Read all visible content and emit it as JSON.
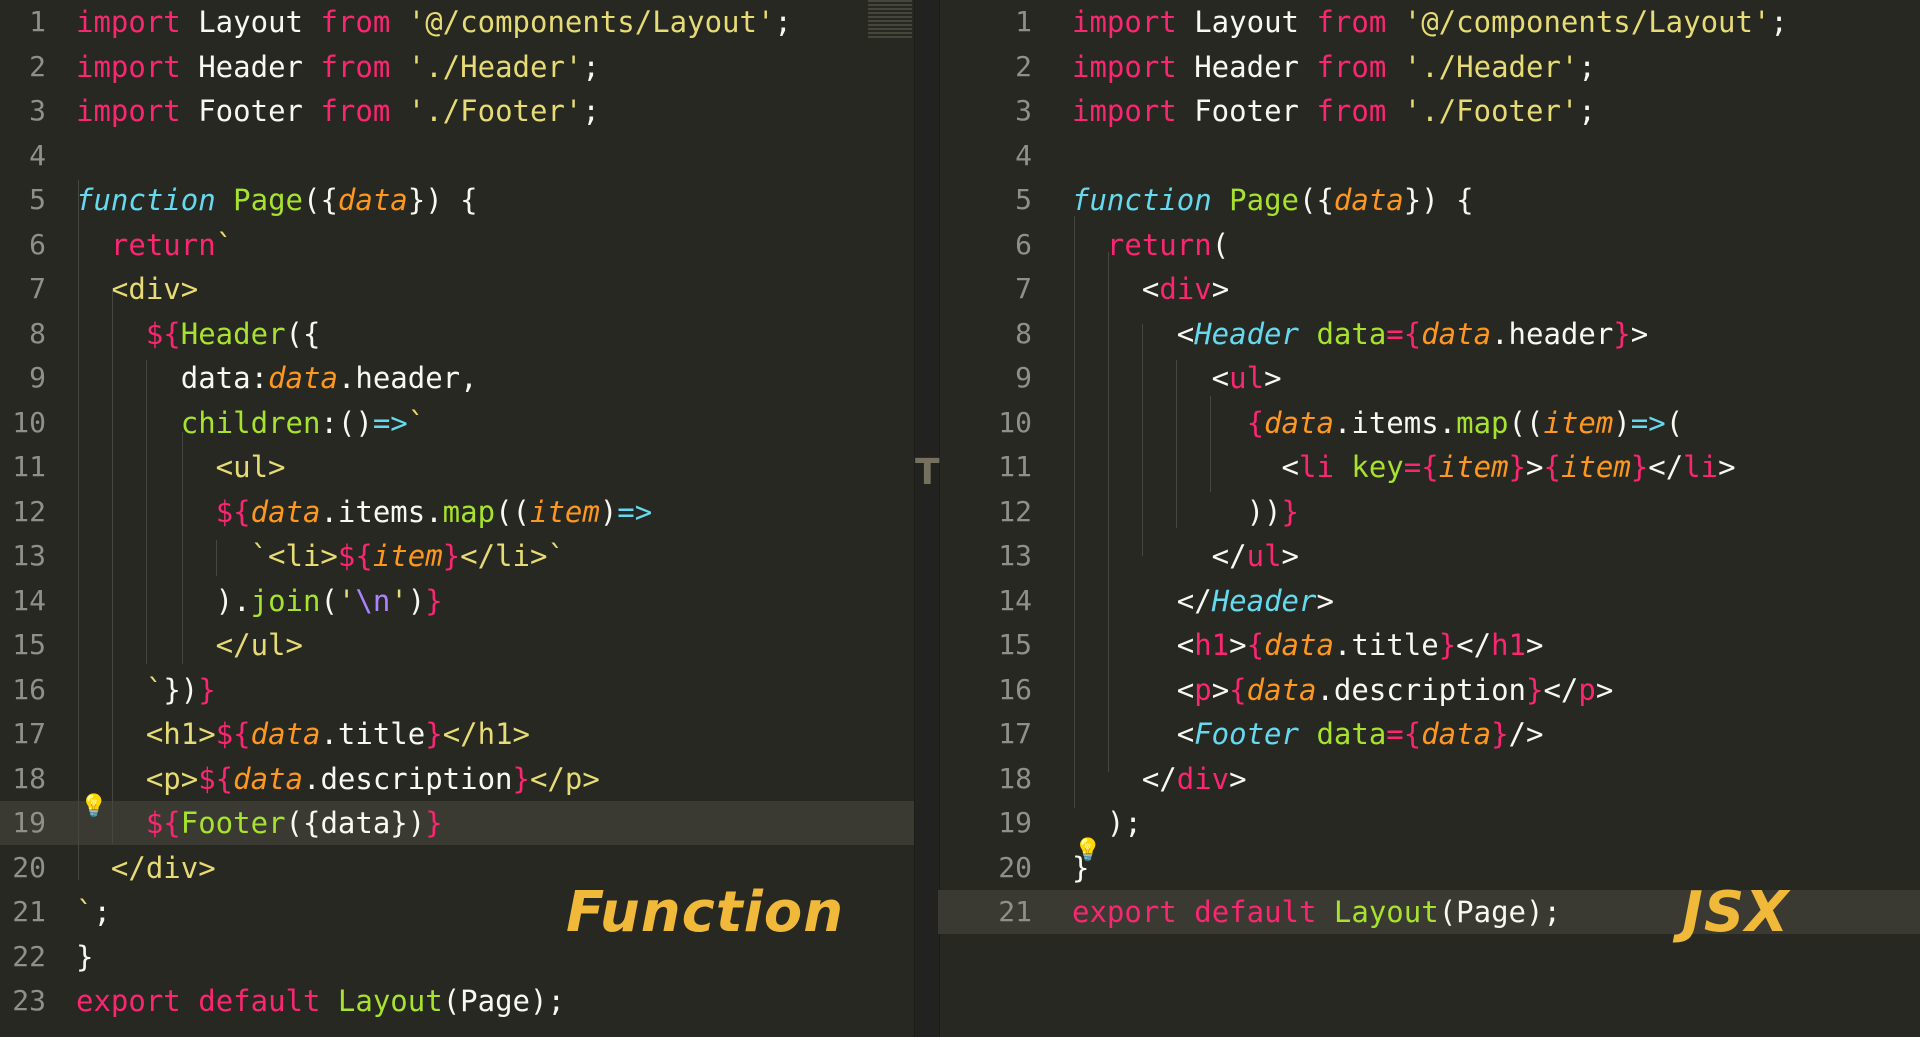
{
  "left_panel": {
    "lines": [
      {
        "n": "1",
        "t": [
          {
            "c": "kw",
            "v": "import"
          },
          {
            "c": "",
            "v": " Layout "
          },
          {
            "c": "kw",
            "v": "from"
          },
          {
            "c": "",
            "v": " "
          },
          {
            "c": "st",
            "v": "'@/components/Layout'"
          },
          {
            "c": "",
            "v": ";"
          }
        ]
      },
      {
        "n": "2",
        "t": [
          {
            "c": "kw",
            "v": "import"
          },
          {
            "c": "",
            "v": " Header "
          },
          {
            "c": "kw",
            "v": "from"
          },
          {
            "c": "",
            "v": " "
          },
          {
            "c": "st",
            "v": "'./Header'"
          },
          {
            "c": "",
            "v": ";"
          }
        ]
      },
      {
        "n": "3",
        "t": [
          {
            "c": "kw",
            "v": "import"
          },
          {
            "c": "",
            "v": " Footer "
          },
          {
            "c": "kw",
            "v": "from"
          },
          {
            "c": "",
            "v": " "
          },
          {
            "c": "st",
            "v": "'./Footer'"
          },
          {
            "c": "",
            "v": ";"
          }
        ]
      },
      {
        "n": "4",
        "t": []
      },
      {
        "n": "5",
        "t": [
          {
            "c": "sf",
            "v": "function"
          },
          {
            "c": "",
            "v": " "
          },
          {
            "c": "fn",
            "v": "Page"
          },
          {
            "c": "",
            "v": "({"
          },
          {
            "c": "ar",
            "v": "data"
          },
          {
            "c": "",
            "v": "}) {"
          }
        ]
      },
      {
        "n": "6",
        "t": [
          {
            "c": "",
            "v": "  "
          },
          {
            "c": "kw",
            "v": "return"
          },
          {
            "c": "st",
            "v": "`"
          }
        ]
      },
      {
        "n": "7",
        "t": [
          {
            "c": "st",
            "v": "  <div>"
          }
        ]
      },
      {
        "n": "8",
        "t": [
          {
            "c": "",
            "v": "    "
          },
          {
            "c": "kw",
            "v": "${"
          },
          {
            "c": "fn",
            "v": "Header"
          },
          {
            "c": "",
            "v": "({"
          }
        ]
      },
      {
        "n": "9",
        "t": [
          {
            "c": "",
            "v": "      data:"
          },
          {
            "c": "ar",
            "v": "data"
          },
          {
            "c": "",
            "v": ".header,"
          }
        ]
      },
      {
        "n": "10",
        "t": [
          {
            "c": "",
            "v": "      "
          },
          {
            "c": "fn",
            "v": "children"
          },
          {
            "c": "",
            "v": ":()"
          },
          {
            "c": "cy",
            "v": "=>"
          },
          {
            "c": "st",
            "v": "`"
          }
        ]
      },
      {
        "n": "11",
        "t": [
          {
            "c": "st",
            "v": "        <ul>"
          }
        ]
      },
      {
        "n": "12",
        "t": [
          {
            "c": "",
            "v": "        "
          },
          {
            "c": "kw",
            "v": "${"
          },
          {
            "c": "ar",
            "v": "data"
          },
          {
            "c": "",
            "v": ".items."
          },
          {
            "c": "fn",
            "v": "map"
          },
          {
            "c": "",
            "v": "(("
          },
          {
            "c": "ar",
            "v": "item"
          },
          {
            "c": "",
            "v": ")"
          },
          {
            "c": "cy",
            "v": "=>"
          }
        ]
      },
      {
        "n": "13",
        "t": [
          {
            "c": "st",
            "v": "          `<li>"
          },
          {
            "c": "kw",
            "v": "${"
          },
          {
            "c": "ar",
            "v": "item"
          },
          {
            "c": "kw",
            "v": "}"
          },
          {
            "c": "st",
            "v": "</li>`"
          }
        ]
      },
      {
        "n": "14",
        "t": [
          {
            "c": "",
            "v": "        )."
          },
          {
            "c": "fn",
            "v": "join"
          },
          {
            "c": "",
            "v": "("
          },
          {
            "c": "st",
            "v": "'"
          },
          {
            "c": "pu",
            "v": "\\n"
          },
          {
            "c": "st",
            "v": "'"
          },
          {
            "c": "",
            "v": ")"
          },
          {
            "c": "kw",
            "v": "}"
          }
        ]
      },
      {
        "n": "15",
        "t": [
          {
            "c": "st",
            "v": "        </ul>"
          }
        ]
      },
      {
        "n": "16",
        "t": [
          {
            "c": "st",
            "v": "    `"
          },
          {
            "c": "",
            "v": "})"
          },
          {
            "c": "kw",
            "v": "}"
          }
        ]
      },
      {
        "n": "17",
        "t": [
          {
            "c": "st",
            "v": "    <h1>"
          },
          {
            "c": "kw",
            "v": "${"
          },
          {
            "c": "ar",
            "v": "data"
          },
          {
            "c": "",
            "v": ".title"
          },
          {
            "c": "kw",
            "v": "}"
          },
          {
            "c": "st",
            "v": "</h1>"
          }
        ]
      },
      {
        "n": "18",
        "t": [
          {
            "c": "st",
            "v": "    <p>"
          },
          {
            "c": "kw",
            "v": "${"
          },
          {
            "c": "ar",
            "v": "data"
          },
          {
            "c": "",
            "v": ".description"
          },
          {
            "c": "kw",
            "v": "}"
          },
          {
            "c": "st",
            "v": "</p>"
          }
        ]
      },
      {
        "n": "19",
        "t": [
          {
            "c": "",
            "v": "    "
          },
          {
            "c": "kw",
            "v": "${"
          },
          {
            "c": "fn",
            "v": "Footer"
          },
          {
            "c": "",
            "v": "({data})"
          },
          {
            "c": "kw",
            "v": "}"
          }
        ]
      },
      {
        "n": "20",
        "t": [
          {
            "c": "st",
            "v": "  </div>"
          }
        ]
      },
      {
        "n": "21",
        "t": [
          {
            "c": "st",
            "v": "`"
          },
          {
            "c": "",
            "v": ";"
          }
        ]
      },
      {
        "n": "22",
        "t": [
          {
            "c": "",
            "v": "}"
          }
        ]
      },
      {
        "n": "23",
        "t": [
          {
            "c": "kw",
            "v": "export"
          },
          {
            "c": "",
            "v": " "
          },
          {
            "c": "kw",
            "v": "default"
          },
          {
            "c": "",
            "v": " "
          },
          {
            "c": "fn",
            "v": "Layout"
          },
          {
            "c": "",
            "v": "(Page);"
          }
        ]
      }
    ],
    "highlighted_line": "19",
    "watermark": "Function"
  },
  "right_panel": {
    "lines": [
      {
        "n": "1",
        "t": [
          {
            "c": "kw",
            "v": "import"
          },
          {
            "c": "",
            "v": " Layout "
          },
          {
            "c": "kw",
            "v": "from"
          },
          {
            "c": "",
            "v": " "
          },
          {
            "c": "st",
            "v": "'@/components/Layout'"
          },
          {
            "c": "",
            "v": ";"
          }
        ]
      },
      {
        "n": "2",
        "t": [
          {
            "c": "kw",
            "v": "import"
          },
          {
            "c": "",
            "v": " Header "
          },
          {
            "c": "kw",
            "v": "from"
          },
          {
            "c": "",
            "v": " "
          },
          {
            "c": "st",
            "v": "'./Header'"
          },
          {
            "c": "",
            "v": ";"
          }
        ]
      },
      {
        "n": "3",
        "t": [
          {
            "c": "kw",
            "v": "import"
          },
          {
            "c": "",
            "v": " Footer "
          },
          {
            "c": "kw",
            "v": "from"
          },
          {
            "c": "",
            "v": " "
          },
          {
            "c": "st",
            "v": "'./Footer'"
          },
          {
            "c": "",
            "v": ";"
          }
        ]
      },
      {
        "n": "4",
        "t": []
      },
      {
        "n": "5",
        "t": [
          {
            "c": "sf",
            "v": "function"
          },
          {
            "c": "",
            "v": " "
          },
          {
            "c": "fn",
            "v": "Page"
          },
          {
            "c": "",
            "v": "({"
          },
          {
            "c": "ar",
            "v": "data"
          },
          {
            "c": "",
            "v": "}) {"
          }
        ]
      },
      {
        "n": "6",
        "t": [
          {
            "c": "",
            "v": "  "
          },
          {
            "c": "kw",
            "v": "return"
          },
          {
            "c": "",
            "v": "("
          }
        ]
      },
      {
        "n": "7",
        "t": [
          {
            "c": "",
            "v": "    <"
          },
          {
            "c": "tg",
            "v": "div"
          },
          {
            "c": "",
            "v": ">"
          }
        ]
      },
      {
        "n": "8",
        "t": [
          {
            "c": "",
            "v": "      <"
          },
          {
            "c": "sf",
            "v": "Header"
          },
          {
            "c": "",
            "v": " "
          },
          {
            "c": "fn",
            "v": "data"
          },
          {
            "c": "kw",
            "v": "={"
          },
          {
            "c": "ar",
            "v": "data"
          },
          {
            "c": "",
            "v": ".header"
          },
          {
            "c": "kw",
            "v": "}"
          },
          {
            "c": "",
            "v": ">"
          }
        ]
      },
      {
        "n": "9",
        "t": [
          {
            "c": "",
            "v": "        <"
          },
          {
            "c": "tg",
            "v": "ul"
          },
          {
            "c": "",
            "v": ">"
          }
        ]
      },
      {
        "n": "10",
        "t": [
          {
            "c": "",
            "v": "          "
          },
          {
            "c": "kw",
            "v": "{"
          },
          {
            "c": "ar",
            "v": "data"
          },
          {
            "c": "",
            "v": ".items."
          },
          {
            "c": "fn",
            "v": "map"
          },
          {
            "c": "",
            "v": "(("
          },
          {
            "c": "ar",
            "v": "item"
          },
          {
            "c": "",
            "v": ")"
          },
          {
            "c": "cy",
            "v": "=>"
          },
          {
            "c": "",
            "v": "("
          }
        ]
      },
      {
        "n": "11",
        "t": [
          {
            "c": "",
            "v": "            <"
          },
          {
            "c": "tg",
            "v": "li"
          },
          {
            "c": "",
            "v": " "
          },
          {
            "c": "fn",
            "v": "key"
          },
          {
            "c": "kw",
            "v": "={"
          },
          {
            "c": "ar",
            "v": "item"
          },
          {
            "c": "kw",
            "v": "}"
          },
          {
            "c": "",
            "v": ">"
          },
          {
            "c": "kw",
            "v": "{"
          },
          {
            "c": "ar",
            "v": "item"
          },
          {
            "c": "kw",
            "v": "}"
          },
          {
            "c": "",
            "v": "</"
          },
          {
            "c": "tg",
            "v": "li"
          },
          {
            "c": "",
            "v": ">"
          }
        ]
      },
      {
        "n": "12",
        "t": [
          {
            "c": "",
            "v": "          ))"
          },
          {
            "c": "kw",
            "v": "}"
          }
        ]
      },
      {
        "n": "13",
        "t": [
          {
            "c": "",
            "v": "        </"
          },
          {
            "c": "tg",
            "v": "ul"
          },
          {
            "c": "",
            "v": ">"
          }
        ]
      },
      {
        "n": "14",
        "t": [
          {
            "c": "",
            "v": "      </"
          },
          {
            "c": "sf",
            "v": "Header"
          },
          {
            "c": "",
            "v": ">"
          }
        ]
      },
      {
        "n": "15",
        "t": [
          {
            "c": "",
            "v": "      <"
          },
          {
            "c": "tg",
            "v": "h1"
          },
          {
            "c": "",
            "v": ">"
          },
          {
            "c": "kw",
            "v": "{"
          },
          {
            "c": "ar",
            "v": "data"
          },
          {
            "c": "",
            "v": ".title"
          },
          {
            "c": "kw",
            "v": "}"
          },
          {
            "c": "",
            "v": "</"
          },
          {
            "c": "tg",
            "v": "h1"
          },
          {
            "c": "",
            "v": ">"
          }
        ]
      },
      {
        "n": "16",
        "t": [
          {
            "c": "",
            "v": "      <"
          },
          {
            "c": "tg",
            "v": "p"
          },
          {
            "c": "",
            "v": ">"
          },
          {
            "c": "kw",
            "v": "{"
          },
          {
            "c": "ar",
            "v": "data"
          },
          {
            "c": "",
            "v": ".description"
          },
          {
            "c": "kw",
            "v": "}"
          },
          {
            "c": "",
            "v": "</"
          },
          {
            "c": "tg",
            "v": "p"
          },
          {
            "c": "",
            "v": ">"
          }
        ]
      },
      {
        "n": "17",
        "t": [
          {
            "c": "",
            "v": "      <"
          },
          {
            "c": "sf",
            "v": "Footer"
          },
          {
            "c": "",
            "v": " "
          },
          {
            "c": "fn",
            "v": "data"
          },
          {
            "c": "kw",
            "v": "={"
          },
          {
            "c": "ar",
            "v": "data"
          },
          {
            "c": "kw",
            "v": "}"
          },
          {
            "c": "",
            "v": "/>"
          }
        ]
      },
      {
        "n": "18",
        "t": [
          {
            "c": "",
            "v": "    </"
          },
          {
            "c": "tg",
            "v": "div"
          },
          {
            "c": "",
            "v": ">"
          }
        ]
      },
      {
        "n": "19",
        "t": [
          {
            "c": "",
            "v": "  );"
          }
        ]
      },
      {
        "n": "20",
        "t": [
          {
            "c": "",
            "v": "}"
          }
        ]
      },
      {
        "n": "21",
        "t": [
          {
            "c": "kw",
            "v": "export"
          },
          {
            "c": "",
            "v": " "
          },
          {
            "c": "kw",
            "v": "default"
          },
          {
            "c": "",
            "v": " "
          },
          {
            "c": "fn",
            "v": "Layout"
          },
          {
            "c": "",
            "v": "(Page);"
          }
        ]
      }
    ],
    "highlighted_line": "21",
    "watermark": "JSX"
  },
  "divider_glyph": "T",
  "colors": {
    "background": "#272822",
    "keyword": "#f92672",
    "string": "#e6db74",
    "function": "#a6e22e",
    "storage": "#66d9ef",
    "argument": "#fd971f",
    "constant": "#ae81ff",
    "watermark": "#f0b93a"
  },
  "icons": [
    "lightbulb-icon"
  ]
}
